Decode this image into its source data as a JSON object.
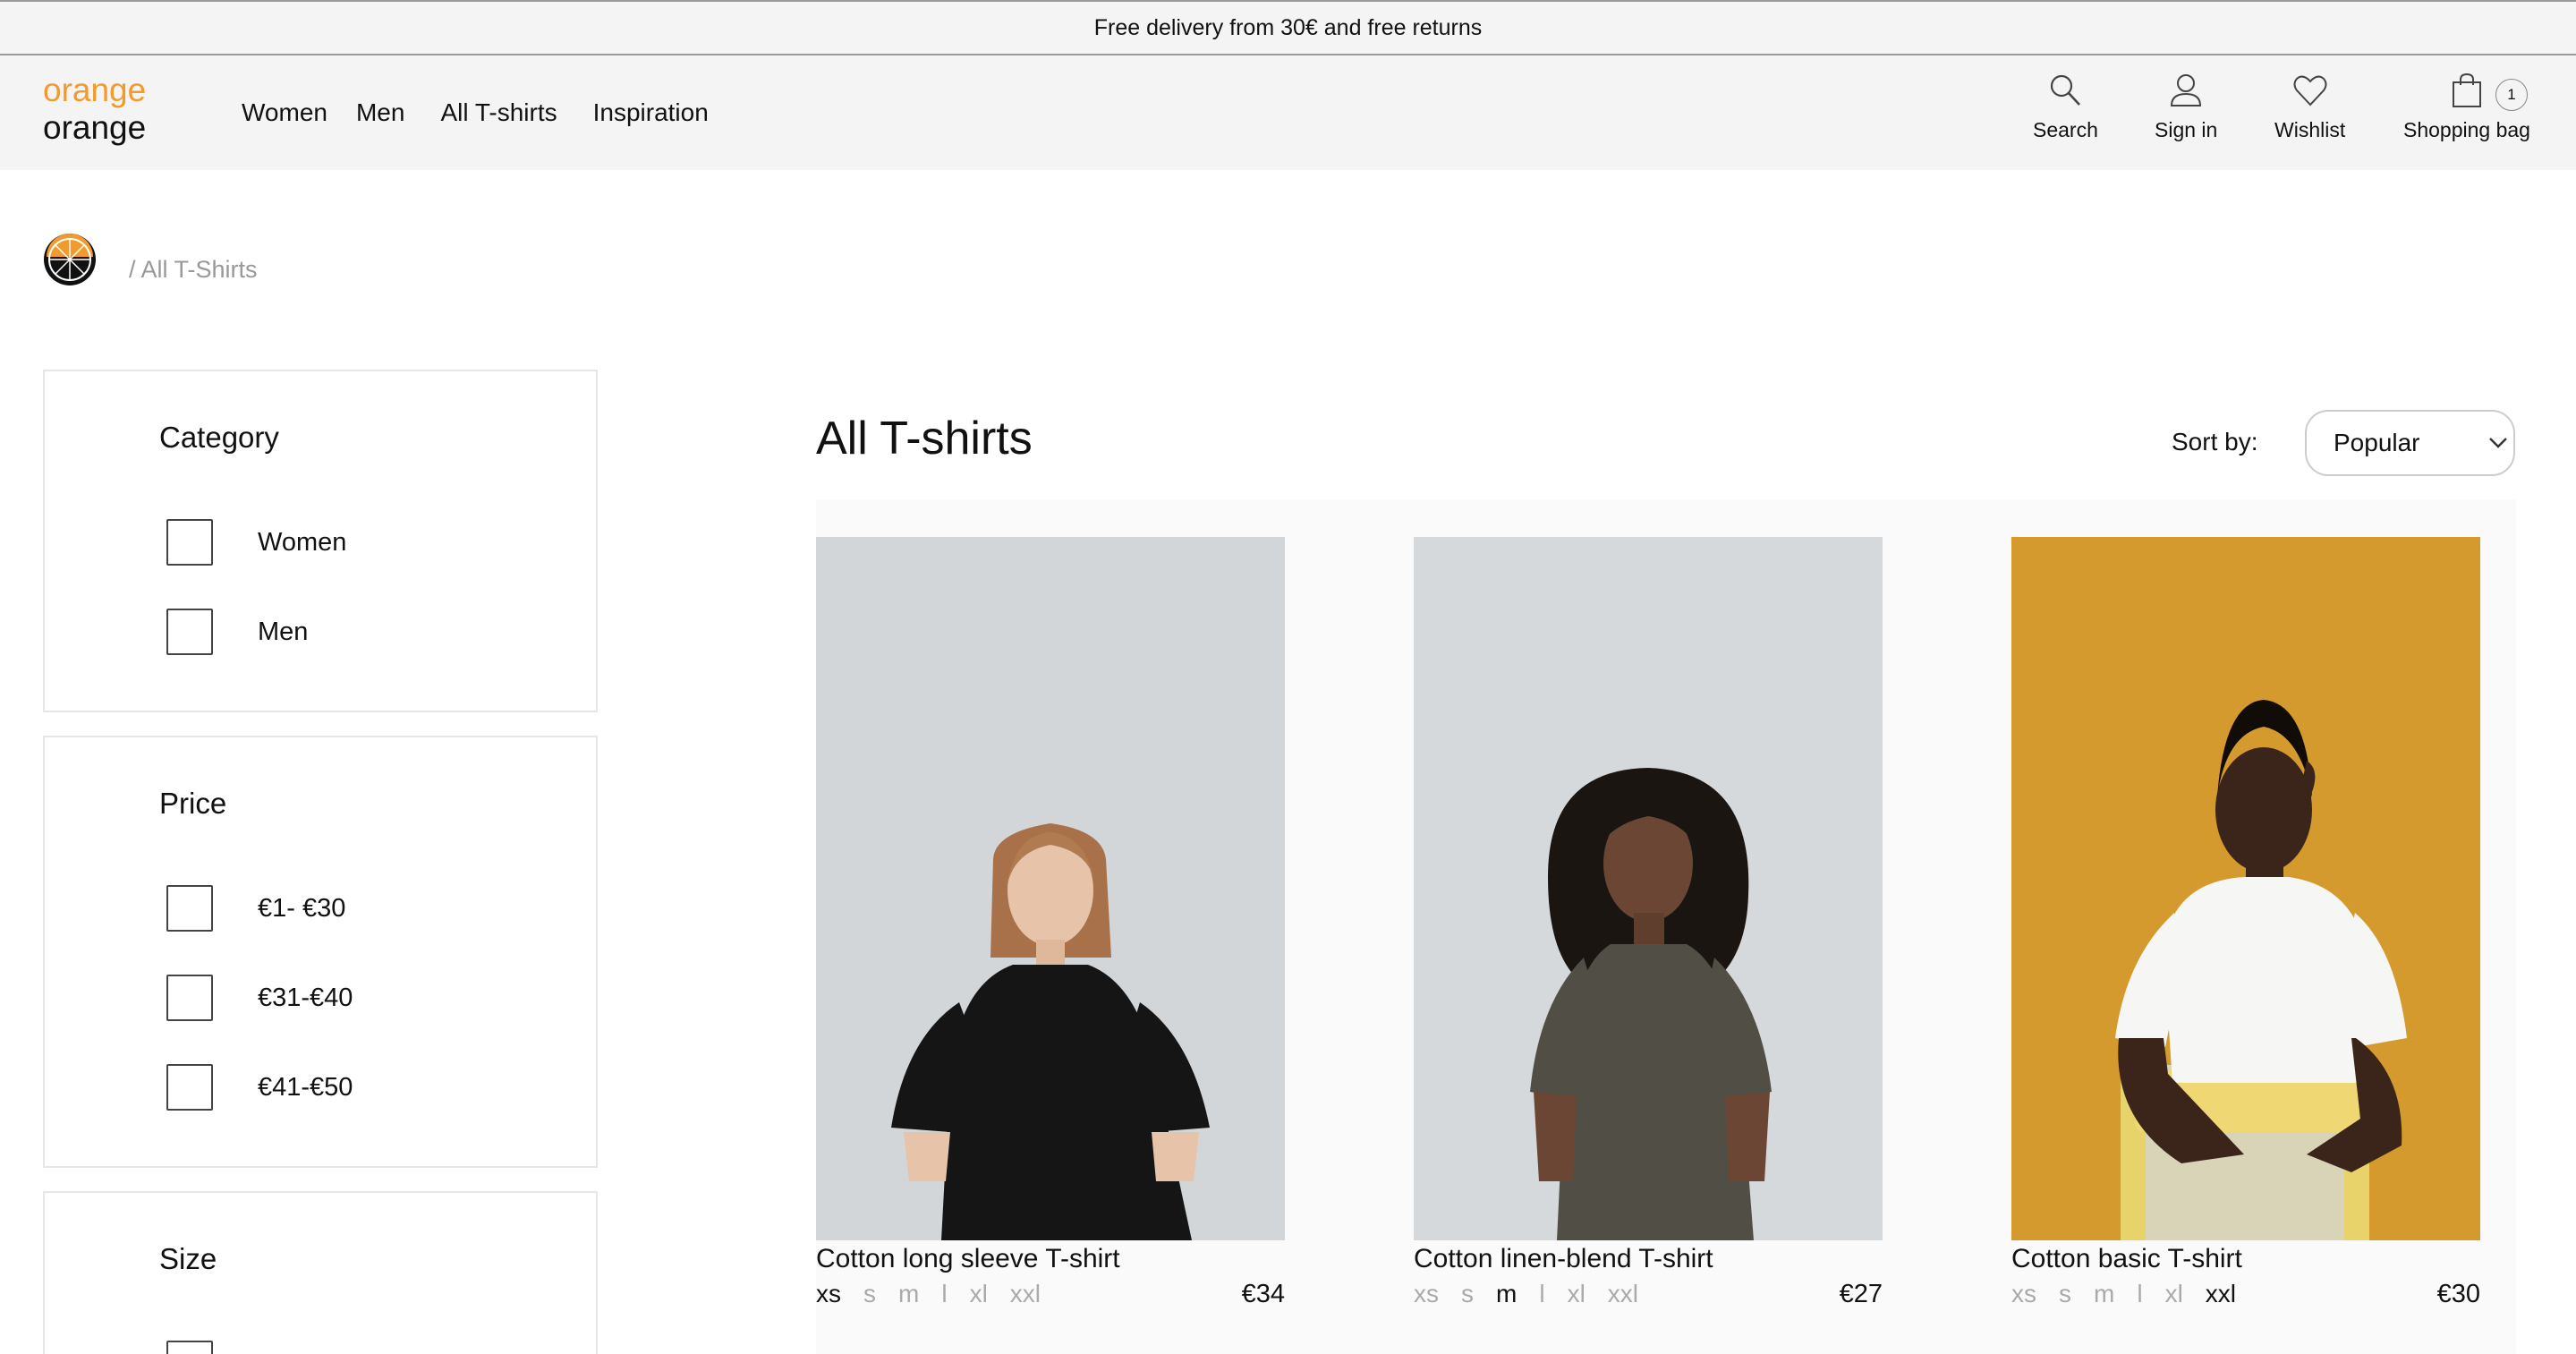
{
  "banner": {
    "text": "Free delivery from 30€ and free returns"
  },
  "logo": {
    "line1": "orange",
    "line2": "orange"
  },
  "nav": {
    "items": [
      "Women",
      "Men",
      "All T-shirts",
      "Inspiration"
    ]
  },
  "header_actions": {
    "search": "Search",
    "sign_in": "Sign in",
    "wishlist": "Wishlist",
    "bag": "Shopping bag",
    "bag_count": "1"
  },
  "breadcrumb": {
    "current": "/ All T-Shirts"
  },
  "filters": {
    "category": {
      "title": "Category",
      "options": [
        "Women",
        "Men"
      ]
    },
    "price": {
      "title": "Price",
      "options": [
        "€1- €30",
        "€31-€40",
        "€41-€50"
      ]
    },
    "size": {
      "title": "Size"
    }
  },
  "listing": {
    "title": "All T-shirts",
    "sort_label": "Sort by:",
    "sort_value": "Popular"
  },
  "products": [
    {
      "name": "Cotton long sleeve T-shirt",
      "price": "€34",
      "sizes": [
        "xs",
        "s",
        "m",
        "l",
        "xl",
        "xxl"
      ],
      "available": [
        "xs"
      ]
    },
    {
      "name": "Cotton linen-blend T-shirt",
      "price": "€27",
      "sizes": [
        "xs",
        "s",
        "m",
        "l",
        "xl",
        "xxl"
      ],
      "available": [
        "m"
      ]
    },
    {
      "name": "Cotton basic T-shirt",
      "price": "€30",
      "sizes": [
        "xs",
        "s",
        "m",
        "l",
        "xl",
        "xxl"
      ],
      "available": [
        "xxl"
      ]
    }
  ],
  "colors": {
    "brand": "#f29a2c",
    "photo_grey": "#d3d6d9",
    "photo_mustard": "#d49a2e"
  }
}
